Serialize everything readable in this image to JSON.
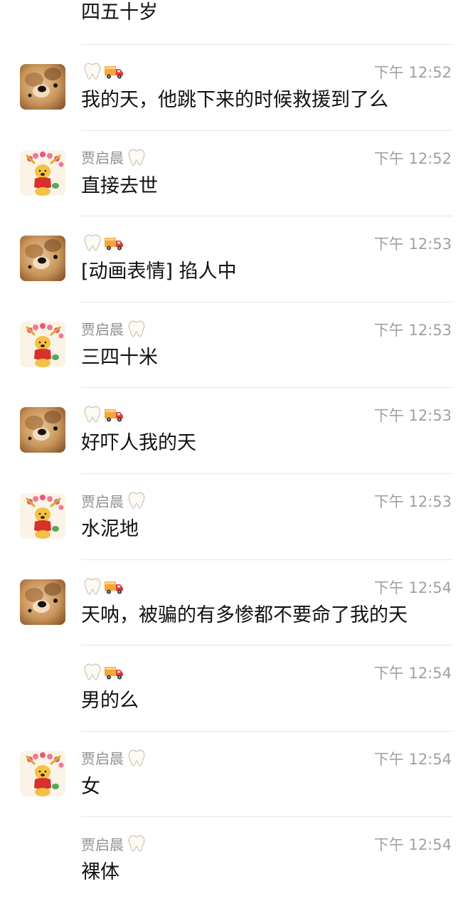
{
  "chat": {
    "top_fragment": "四五十岁",
    "time_prefix": "下午",
    "messages": [
      {
        "sender": "",
        "sender_icons": [
          "tooth-icon",
          "delivery-truck-icon"
        ],
        "avatar": "dog",
        "time": "下午 12:52",
        "text": "我的天，他跳下来的时候救援到了么"
      },
      {
        "sender": "贾启晨",
        "sender_icons": [
          "tooth-icon"
        ],
        "avatar": "pooh",
        "time": "下午 12:52",
        "text": "直接去世"
      },
      {
        "sender": "",
        "sender_icons": [
          "tooth-icon",
          "delivery-truck-icon"
        ],
        "avatar": "dog",
        "time": "下午 12:53",
        "text": "[动画表情] 掐人中"
      },
      {
        "sender": "贾启晨",
        "sender_icons": [
          "tooth-icon"
        ],
        "avatar": "pooh",
        "time": "下午 12:53",
        "text": "三四十米"
      },
      {
        "sender": "",
        "sender_icons": [
          "tooth-icon",
          "delivery-truck-icon"
        ],
        "avatar": "dog",
        "time": "下午 12:53",
        "text": "好吓人我的天"
      },
      {
        "sender": "贾启晨",
        "sender_icons": [
          "tooth-icon"
        ],
        "avatar": "pooh",
        "time": "下午 12:53",
        "text": "水泥地"
      },
      {
        "sender": "",
        "sender_icons": [
          "tooth-icon",
          "delivery-truck-icon"
        ],
        "avatar": "dog",
        "time": "下午 12:54",
        "text": "天呐，被骗的有多惨都不要命了我的天"
      },
      {
        "sender": "",
        "sender_icons": [
          "tooth-icon",
          "delivery-truck-icon"
        ],
        "avatar": "",
        "time": "下午 12:54",
        "text": "男的么"
      },
      {
        "sender": "贾启晨",
        "sender_icons": [
          "tooth-icon"
        ],
        "avatar": "pooh",
        "time": "下午 12:54",
        "text": "女"
      },
      {
        "sender": "贾启晨",
        "sender_icons": [
          "tooth-icon"
        ],
        "avatar": "",
        "time": "下午 12:54",
        "text": "裸体"
      }
    ]
  },
  "colors": {
    "text": "#111111",
    "sender": "#8f8f8f",
    "time": "#a0a0a0",
    "divider": "#e6e6e6",
    "background": "#ffffff"
  }
}
